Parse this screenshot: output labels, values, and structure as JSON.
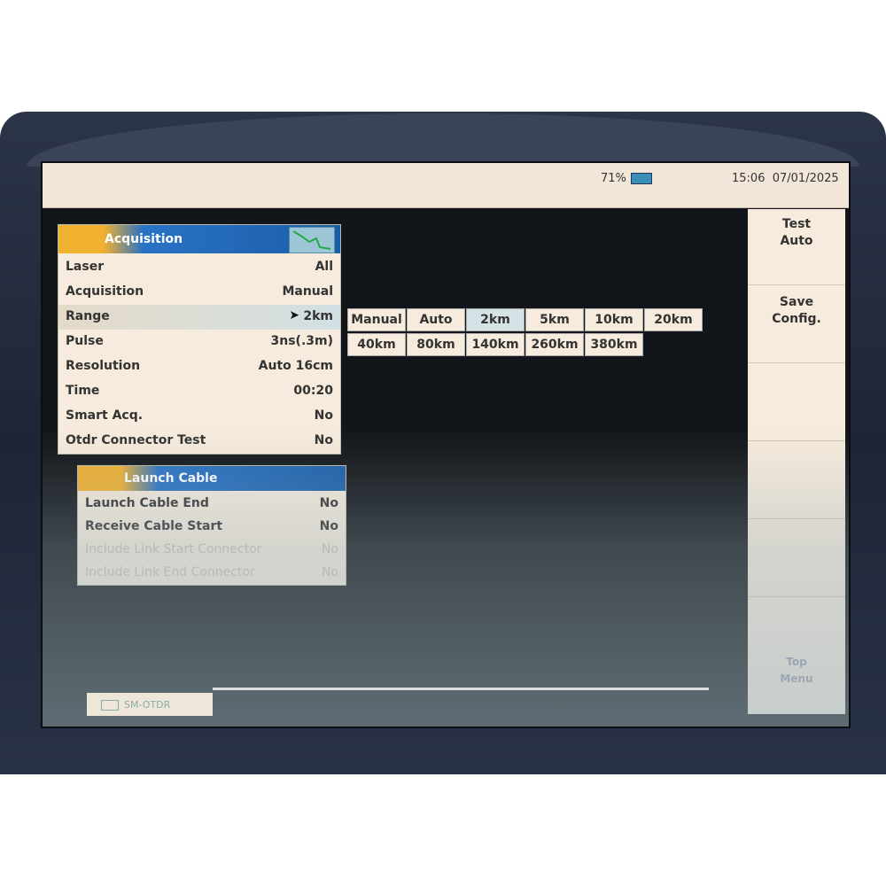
{
  "status": {
    "battery": "71%",
    "time": "15:06",
    "date": "07/01/2025"
  },
  "softkeys": {
    "test": [
      "Test",
      "Auto"
    ],
    "save": [
      "Save",
      "Config."
    ],
    "top_menu": [
      "Top",
      "Menu"
    ]
  },
  "acquisition": {
    "title": "Acquisition",
    "rows": [
      {
        "label": "Laser",
        "value": "All"
      },
      {
        "label": "Acquisition",
        "value": "Manual"
      },
      {
        "label": "Range",
        "value": "2km"
      },
      {
        "label": "Pulse",
        "value": "3ns(.3m)"
      },
      {
        "label": "Resolution",
        "value": "Auto 16cm"
      },
      {
        "label": "Time",
        "value": "00:20"
      },
      {
        "label": "Smart Acq.",
        "value": "No"
      },
      {
        "label": "Otdr Connector Test",
        "value": "No"
      }
    ]
  },
  "range_options": [
    "Manual",
    "Auto",
    "2km",
    "5km",
    "10km",
    "20km",
    "40km",
    "80km",
    "140km",
    "260km",
    "380km"
  ],
  "launch_cable": {
    "title": "Launch Cable",
    "rows": [
      {
        "label": "Launch Cable End",
        "value": "No"
      },
      {
        "label": "Receive Cable Start",
        "value": "No"
      },
      {
        "label": "Include Link Start Connector",
        "value": "No"
      },
      {
        "label": "Include Link End Connector",
        "value": "No"
      }
    ]
  },
  "bottom_tab": "SM-OTDR",
  "icons": [
    "battery-icon",
    "trace-icon",
    "pointer-icon",
    "otdr-module-icon"
  ]
}
